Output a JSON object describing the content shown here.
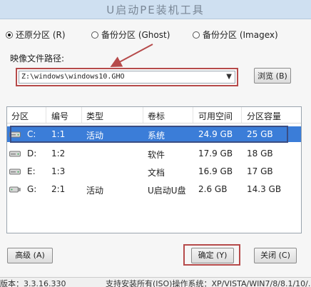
{
  "window": {
    "title": "U启动PE装机工具"
  },
  "mode": {
    "options": [
      {
        "label": "还原分区 (R)",
        "checked": true
      },
      {
        "label": "备份分区 (Ghost)",
        "checked": false
      },
      {
        "label": "备份分区 (Imagex)",
        "checked": false
      }
    ]
  },
  "image_path": {
    "label": "映像文件路径:",
    "value": "Z:\\windows\\windows10.GHO",
    "browse_label": "浏览 (B)"
  },
  "table": {
    "headers": [
      "分区",
      "编号",
      "类型",
      "卷标",
      "可用空间",
      "分区容量"
    ],
    "rows": [
      {
        "part": "C:",
        "num": "1:1",
        "type": "活动",
        "label": "系统",
        "free": "24.9 GB",
        "size": "25 GB",
        "selected": true
      },
      {
        "part": "D:",
        "num": "1:2",
        "type": "",
        "label": "软件",
        "free": "17.9 GB",
        "size": "18 GB",
        "selected": false
      },
      {
        "part": "E:",
        "num": "1:3",
        "type": "",
        "label": "文档",
        "free": "16.9 GB",
        "size": "17 GB",
        "selected": false
      },
      {
        "part": "G:",
        "num": "2:1",
        "type": "活动",
        "label": "U启动U盘",
        "free": "2.6 GB",
        "size": "14.3 GB",
        "selected": false
      }
    ]
  },
  "buttons": {
    "advanced": "高级 (A)",
    "ok": "确定 (Y)",
    "close": "关闭 (C)"
  },
  "status": {
    "version": "版本：3.3.16.330",
    "support": "支持安装所有(ISO)操作系统：XP/VISTA/WIN7/8/8.1/10/..."
  },
  "colors": {
    "highlight_red": "#b64a4a",
    "selection_blue": "#3b7dd8",
    "selection_outline": "#3a4d83"
  }
}
